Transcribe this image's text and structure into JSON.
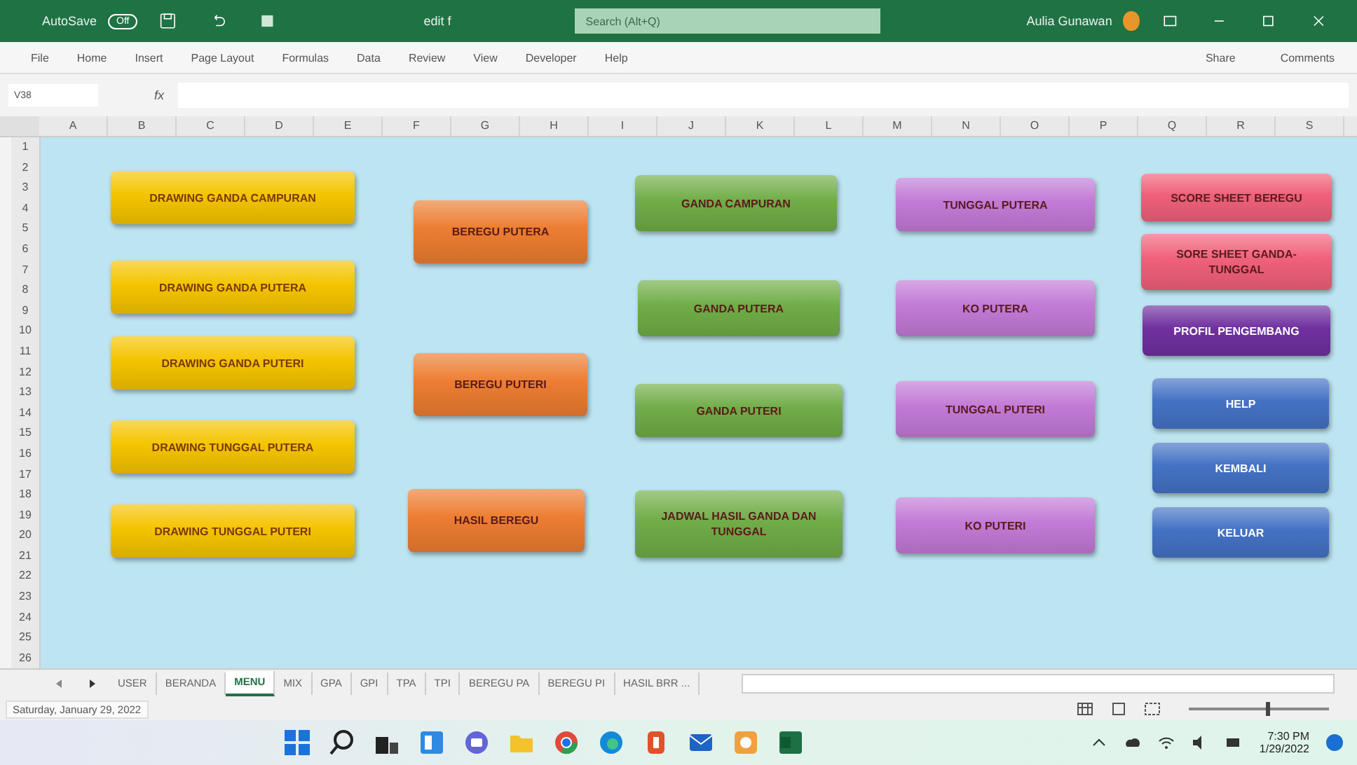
{
  "title_bar": {
    "autosave": "AutoSave",
    "autosave_state": "Off",
    "autosave_on": false,
    "file_name": "edit f",
    "search": {
      "placeholder": "Search (Alt+Q)"
    },
    "user": "Aulia Gunawan"
  },
  "ribbon_tabs": [
    "File",
    "Home",
    "Insert",
    "Page Layout",
    "Formulas",
    "Data",
    "Review",
    "View",
    "Developer",
    "Help"
  ],
  "share": "Share",
  "comments": "Comments",
  "formula_bar": {
    "name_box": "V38",
    "fx": "fx"
  },
  "columns": [
    "A",
    "B",
    "C",
    "D",
    "E",
    "F",
    "G",
    "H",
    "I",
    "J",
    "K",
    "L",
    "M",
    "N",
    "O",
    "P",
    "Q",
    "R",
    "S"
  ],
  "rows": [
    "1",
    "2",
    "3",
    "4",
    "5",
    "6",
    "7",
    "8",
    "9",
    "10",
    "11",
    "12",
    "13",
    "14",
    "15",
    "16",
    "17",
    "18",
    "19",
    "20",
    "21",
    "22",
    "23",
    "24",
    "25",
    "26"
  ],
  "buttons": [
    {
      "label": "DRAWING GANDA CAMPURAN",
      "color": "#f5c400"
    },
    {
      "label": "DRAWING GANDA PUTERA",
      "color": "#f5c400"
    },
    {
      "label": "DRAWING GANDA PUTERI",
      "color": "#f5c400"
    },
    {
      "label": "DRAWING TUNGGAL PUTERA",
      "color": "#f5c400"
    },
    {
      "label": "DRAWING TUNGGAL PUTERI",
      "color": "#f5c400"
    },
    {
      "label": "BEREGU PUTERA",
      "color": "#ed7d31"
    },
    {
      "label": "BEREGU PUTERI",
      "color": "#ed7d31"
    },
    {
      "label": "HASIL BEREGU",
      "color": "#ed7d31"
    },
    {
      "label": "GANDA CAMPURAN",
      "color": "#70ad47"
    },
    {
      "label": "GANDA PUTERA",
      "color": "#70ad47"
    },
    {
      "label": "GANDA PUTERI",
      "color": "#70ad47"
    },
    {
      "label": "JADWAL HASIL GANDA DAN TUNGGAL",
      "color": "#70ad47"
    },
    {
      "label": "TUNGGAL PUTERA",
      "color": "#c27ad6"
    },
    {
      "label": "KO PUTERA",
      "color": "#c27ad6"
    },
    {
      "label": "TUNGGAL PUTERI",
      "color": "#c27ad6"
    },
    {
      "label": "KO PUTERI",
      "color": "#c27ad6"
    },
    {
      "label": "SCORE SHEET BEREGU",
      "color": "#f0607a"
    },
    {
      "label": "SORE SHEET GANDA-TUNGGAL",
      "color": "#f0607a"
    },
    {
      "label": "PROFIL PENGEMBANG",
      "color": "#7030a0"
    },
    {
      "label": "HELP",
      "color": "#4472c4"
    },
    {
      "label": "KEMBALI",
      "color": "#4472c4"
    },
    {
      "label": "KELUAR",
      "color": "#4472c4"
    }
  ],
  "sheet_tabs": [
    {
      "label": "USER",
      "selected": false
    },
    {
      "label": "BERANDA",
      "selected": false
    },
    {
      "label": "MENU",
      "selected": true
    },
    {
      "label": "MIX",
      "selected": false
    },
    {
      "label": "GPA",
      "selected": false
    },
    {
      "label": "GPI",
      "selected": false
    },
    {
      "label": "TPA",
      "selected": false
    },
    {
      "label": "TPI",
      "selected": false
    },
    {
      "label": "BEREGU PA",
      "selected": false
    },
    {
      "label": "BEREGU PI",
      "selected": false
    },
    {
      "label": "HASIL BRR ...",
      "selected": false
    }
  ],
  "status": "Saturday, January 29, 2022",
  "zoom": {
    "level": 0.55
  },
  "clock": {
    "time": "7:30 PM",
    "date": "1/29/2022"
  }
}
